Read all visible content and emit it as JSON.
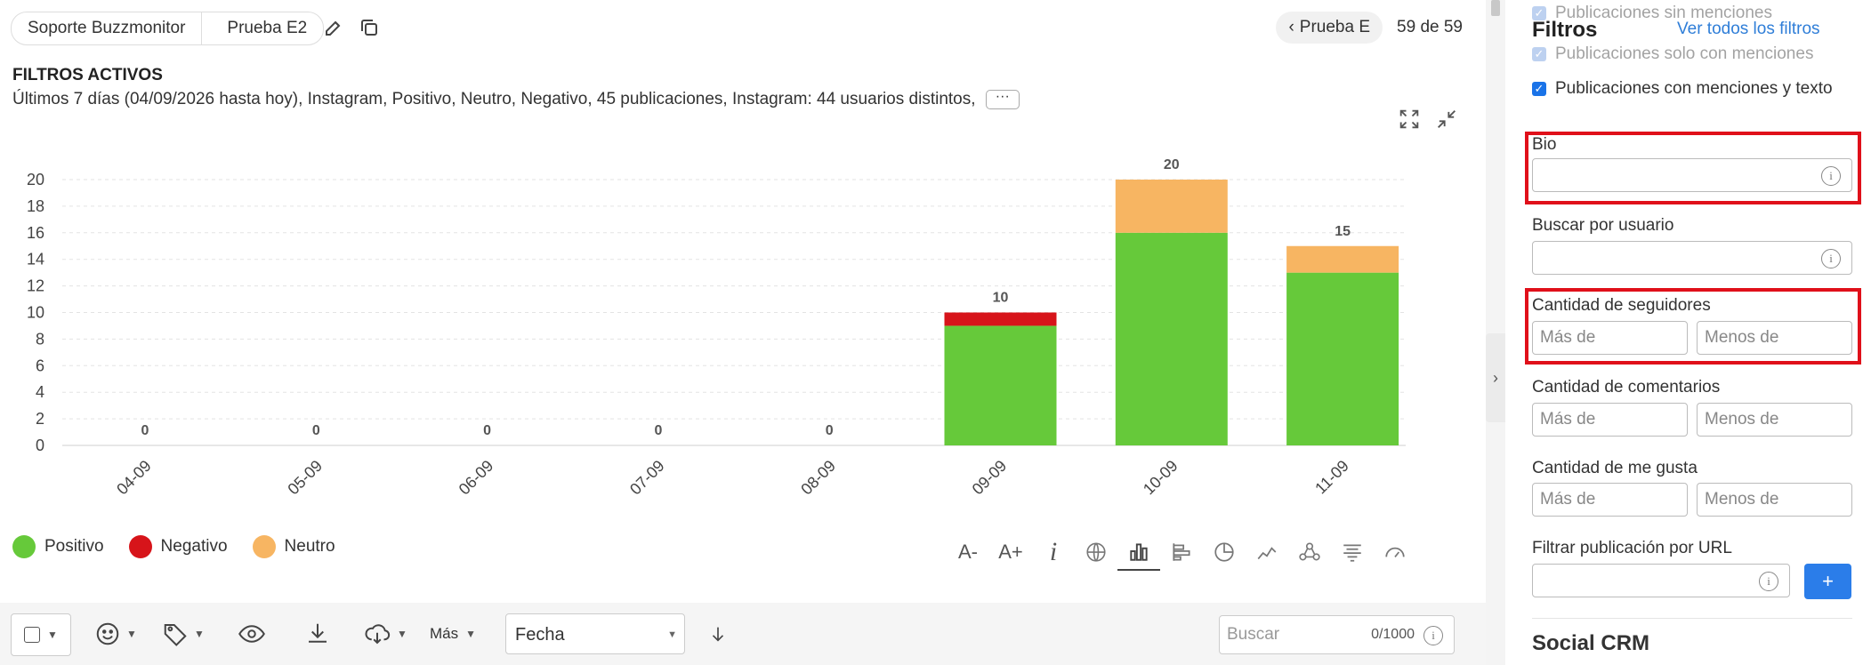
{
  "breadcrumb": {
    "items": [
      "Soporte Buzzmonitor",
      "Prueba E2"
    ]
  },
  "pager": {
    "prev_label": "Prueba E",
    "count": "59 de 59"
  },
  "active_filters": {
    "title": "FILTROS ACTIVOS",
    "description": "Últimos 7 días (04/09/2026 hasta hoy), Instagram, Positivo, Neutro, Negativo, 45 publicaciones, Instagram: 44 usuarios distintos,",
    "more": "···"
  },
  "chart_data": {
    "type": "bar",
    "stacked": true,
    "categories": [
      "04-09",
      "05-09",
      "06-09",
      "07-09",
      "08-09",
      "09-09",
      "10-09",
      "11-09"
    ],
    "series": [
      {
        "name": "Positivo",
        "color": "#66c93a",
        "values": [
          0,
          0,
          0,
          0,
          0,
          9,
          16,
          13
        ]
      },
      {
        "name": "Negativo",
        "color": "#d7141a",
        "values": [
          0,
          0,
          0,
          0,
          0,
          1,
          0,
          0
        ]
      },
      {
        "name": "Neutro",
        "color": "#f7b562",
        "values": [
          0,
          0,
          0,
          0,
          0,
          0,
          4,
          2
        ]
      }
    ],
    "totals": [
      0,
      0,
      0,
      0,
      0,
      10,
      20,
      15
    ],
    "yticks": [
      0,
      2,
      4,
      6,
      8,
      10,
      12,
      14,
      16,
      18,
      20
    ],
    "ylim": [
      0,
      20
    ],
    "grid": true
  },
  "legend": [
    {
      "label": "Positivo",
      "color": "#66c93a"
    },
    {
      "label": "Negativo",
      "color": "#d7141a"
    },
    {
      "label": "Neutro",
      "color": "#f7b562"
    }
  ],
  "chart_tools": {
    "font_down": "A-",
    "font_up": "A+"
  },
  "bottom_bar": {
    "mas_label": "Más",
    "sort_value": "Fecha",
    "search_placeholder": "Buscar",
    "search_counter": "0/1000"
  },
  "sidebar": {
    "title": "Filtros",
    "see_all_link": "Ver todos los filtros",
    "checkboxes": [
      {
        "label": "Publicaciones sin menciones",
        "checked": true,
        "disabled": true
      },
      {
        "label": "Publicaciones solo con menciones",
        "checked": true,
        "disabled": true
      },
      {
        "label": "Publicaciones con menciones y texto",
        "checked": true,
        "disabled": false
      }
    ],
    "bio_label": "Bio",
    "user_search_label": "Buscar por usuario",
    "followers_label": "Cantidad de seguidores",
    "comments_label": "Cantidad de comentarios",
    "likes_label": "Cantidad de me gusta",
    "more_than_placeholder": "Más de",
    "less_than_placeholder": "Menos de",
    "url_filter_label": "Filtrar publicación por URL",
    "add_button": "+",
    "social_crm": "Social CRM"
  }
}
